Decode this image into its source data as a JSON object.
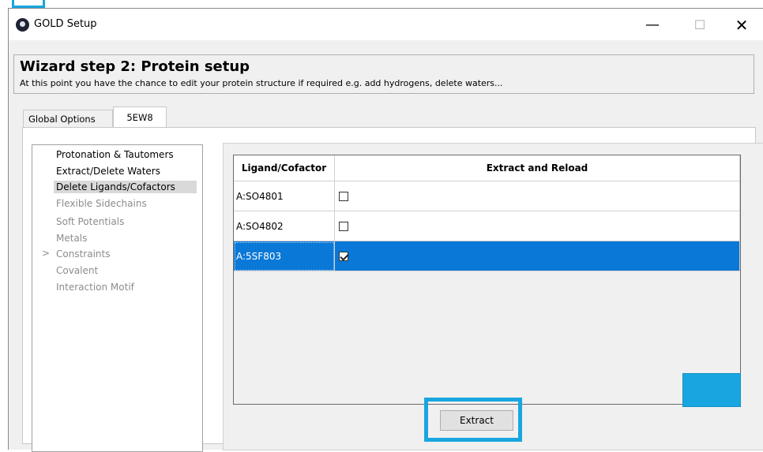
{
  "window": {
    "title": "GOLD Setup",
    "minimize": "—",
    "maximize": "☐",
    "close": "✕"
  },
  "header": {
    "title": "Wizard step 2: Protein setup",
    "subtitle": "At this point you have the chance to edit your protein structure if required e.g. add hydrogens, delete waters..."
  },
  "tabs": [
    {
      "label": "Global Options",
      "active": false
    },
    {
      "label": "5EW8",
      "active": true
    }
  ],
  "nav": {
    "items": [
      {
        "label": "Protonation & Tautomers",
        "enabled": true
      },
      {
        "label": "Extract/Delete Waters",
        "enabled": true
      },
      {
        "label": "Delete Ligands/Cofactors",
        "enabled": true,
        "selected": true
      },
      {
        "label": "Flexible Sidechains",
        "enabled": false
      },
      {
        "label": "Soft Potentials",
        "enabled": false
      },
      {
        "label": "Metals",
        "enabled": false
      },
      {
        "label": "Constraints",
        "enabled": false,
        "expandable": true
      },
      {
        "label": "Covalent",
        "enabled": false
      },
      {
        "label": "Interaction Motif",
        "enabled": false
      }
    ],
    "expander_glyph": ">"
  },
  "grid": {
    "columns": [
      "Ligand/Cofactor",
      "Extract and Reload"
    ],
    "rows": [
      {
        "name": "A:SO4801",
        "checked": false,
        "selected": false
      },
      {
        "name": "A:SO4802",
        "checked": false,
        "selected": false
      },
      {
        "name": "A:5SF803",
        "checked": true,
        "selected": true
      }
    ]
  },
  "buttons": {
    "extract": "Extract"
  },
  "colors": {
    "selection": "#0a78d7",
    "highlight": "#19a6e0"
  }
}
